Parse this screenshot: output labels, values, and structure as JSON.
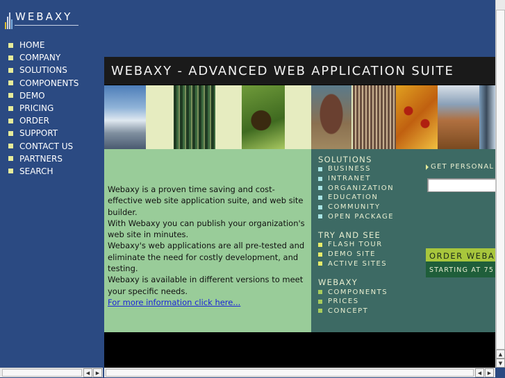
{
  "logo": {
    "text": "WEBAXY"
  },
  "nav": {
    "items": [
      {
        "label": "HOME"
      },
      {
        "label": "COMPANY"
      },
      {
        "label": "SOLUTIONS"
      },
      {
        "label": "COMPONENTS"
      },
      {
        "label": "DEMO"
      },
      {
        "label": "PRICING"
      },
      {
        "label": "ORDER"
      },
      {
        "label": "SUPPORT"
      },
      {
        "label": "CONTACT US"
      },
      {
        "label": "PARTNERS"
      },
      {
        "label": "SEARCH"
      }
    ]
  },
  "banner": {
    "title": "WEBAXY - ADVANCED WEB APPLICATION SUITE"
  },
  "content": {
    "p1": "Webaxy is a proven time saving and cost-effective web site application suite, and web site builder.",
    "p2": "With Webaxy you can publish your organization's web site in minutes.",
    "p3": "Webaxy's web applications are all pre-tested and eliminate the need for costly development, and testing.",
    "p4": "Webaxy is available in different versions to meet your specific needs.",
    "link": "For more information click here..."
  },
  "menu": {
    "solutions": {
      "title": "SOLUTIONS",
      "items": [
        {
          "label": "BUSINESS"
        },
        {
          "label": "INTRANET"
        },
        {
          "label": "ORGANIZATION"
        },
        {
          "label": "EDUCATION"
        },
        {
          "label": "COMMUNITY"
        },
        {
          "label": "OPEN PACKAGE"
        }
      ]
    },
    "try": {
      "title": "TRY AND SEE",
      "items": [
        {
          "label": "FLASH TOUR"
        },
        {
          "label": "DEMO SITE"
        },
        {
          "label": "ACTIVE SITES"
        }
      ]
    },
    "webaxy": {
      "title": "WEBAXY",
      "items": [
        {
          "label": "COMPONENTS"
        },
        {
          "label": "PRICES"
        },
        {
          "label": "CONCEPT"
        }
      ]
    }
  },
  "right": {
    "get_personal": "GET PERSONAL",
    "email_value": "",
    "order_label": "ORDER WEBA",
    "starting_label": "STARTING AT 75"
  },
  "colors": {
    "page_bg": "#2b4a82",
    "nav_square": "#e7ec9a",
    "content_bg": "#99cc99",
    "menu_bg": "#3d6a64",
    "square_blue": "#a8e4e4",
    "square_yellow": "#e7ec6a",
    "square_green": "#a8cc5c",
    "order_bg": "#a8c63c",
    "starting_bg": "#1f5e3a"
  }
}
